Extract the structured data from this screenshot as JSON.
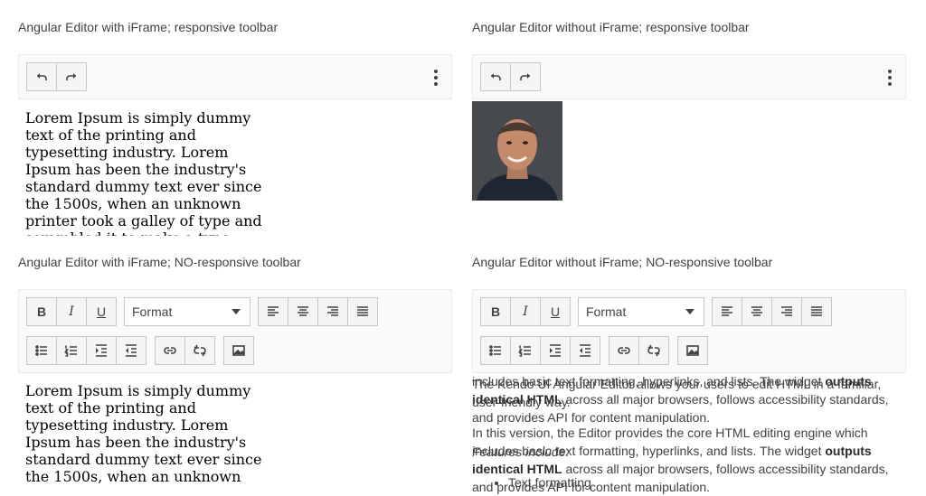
{
  "panels": {
    "p1": {
      "title": "Angular Editor with iFrame; responsive toolbar"
    },
    "p2": {
      "title": "Angular Editor without iFrame; responsive toolbar"
    },
    "p3": {
      "title": "Angular Editor with iFrame; NO-responsive toolbar"
    },
    "p4": {
      "title": "Angular Editor without iFrame; NO-responsive toolbar"
    }
  },
  "toolbar": {
    "format_value": "Format",
    "bold_glyph": "B",
    "italic_glyph": "I",
    "underline_glyph": "U"
  },
  "content": {
    "lorem": "Lorem Ipsum is simply dummy text of the printing and typesetting industry. Lorem Ipsum has been the industry's standard dummy text ever since the 1500s, when an unknown printer took a galley of type and scrambled it to make a type specimen book.",
    "plain_overlap_a": "includes basic text formatting, hyperlinks, and lists. The widget",
    "plain_overlap_b": "The Kendo UI Angular Editor allows your users to edit HTML in a familiar, user-friendly way.",
    "plain_bold_1": "outputs identical HTML",
    "plain_rest_1": "across all major browsers, follows accessibility standards, and provides API for content manipulation.",
    "plain_p2": "In this version, the Editor provides the core HTML editing engine which includes basic text formatting, hyperlinks, and lists. The widget",
    "plain_overlap_c": "Features include:",
    "plain_bold_2": "outputs identical HTML",
    "plain_rest_2": "across all major browsers, follows accessibility standards, and provides API for content manipulation.",
    "list_item_1": "Text formatting"
  },
  "icons": [
    "undo-icon",
    "redo-icon",
    "more-vertical-icon",
    "bold-icon",
    "italic-icon",
    "underline-icon",
    "align-left-icon",
    "align-center-icon",
    "align-right-icon",
    "align-justify-icon",
    "bullet-list-icon",
    "numbered-list-icon",
    "indent-icon",
    "outdent-icon",
    "link-icon",
    "unlink-icon",
    "insert-image-icon",
    "chevron-down-icon"
  ]
}
